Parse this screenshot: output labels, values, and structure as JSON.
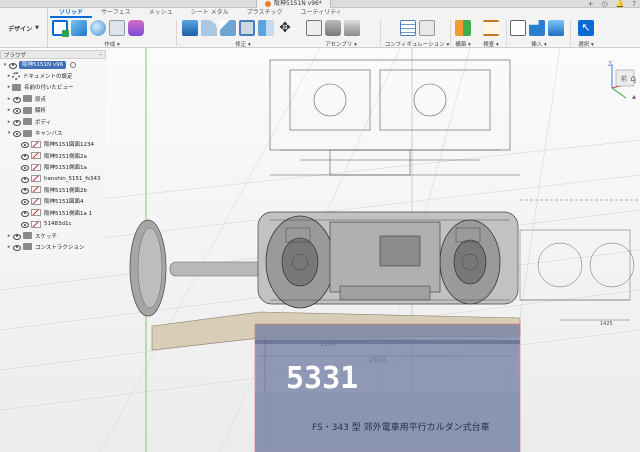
{
  "document": {
    "tab_title": "阪神5151N v96*"
  },
  "workspace": {
    "label": "デザイン"
  },
  "ribbon": {
    "tabs": [
      {
        "label": "ソリッド",
        "active": true
      },
      {
        "label": "サーフェス",
        "active": false
      },
      {
        "label": "メッシュ",
        "active": false
      },
      {
        "label": "シート メタル",
        "active": false
      },
      {
        "label": "プラスチック",
        "active": false
      },
      {
        "label": "ユーティリティ",
        "active": false
      }
    ],
    "groups": {
      "create": "作成",
      "modify": "修正",
      "assemble": "アセンブリ",
      "configure": "コンフィギュレーション",
      "construct": "構築",
      "inspect": "検査",
      "insert": "挿入",
      "select": "選択"
    }
  },
  "browser": {
    "title": "ブラウザ",
    "items": [
      {
        "label": "阪神5151N v96",
        "level": 0,
        "type": "root"
      },
      {
        "label": "ドキュメントの設定",
        "level": 1,
        "type": "gear"
      },
      {
        "label": "名前の付いたビュー",
        "level": 1,
        "type": "folder"
      },
      {
        "label": "原点",
        "level": 1,
        "type": "folder"
      },
      {
        "label": "解析",
        "level": 1,
        "type": "folder"
      },
      {
        "label": "ボディ",
        "level": 1,
        "type": "folder"
      },
      {
        "label": "キャンバス",
        "level": 1,
        "type": "folder-open"
      },
      {
        "label": "阪神5151図面1234",
        "level": 2,
        "type": "canvas"
      },
      {
        "label": "阪神5151側面2a",
        "level": 2,
        "type": "canvas"
      },
      {
        "label": "阪神5151側面1a",
        "level": 2,
        "type": "canvas"
      },
      {
        "label": "hanshin_5151_fs343",
        "level": 2,
        "type": "canvas"
      },
      {
        "label": "阪神5151側面2b",
        "level": 2,
        "type": "canvas"
      },
      {
        "label": "阪神5151図面4",
        "level": 2,
        "type": "canvas"
      },
      {
        "label": "阪神5151側面1a 1",
        "level": 2,
        "type": "canvas"
      },
      {
        "label": "51483d1c",
        "level": 2,
        "type": "canvas"
      },
      {
        "label": "スケッチ",
        "level": 1,
        "type": "folder"
      },
      {
        "label": "コンストラクション",
        "level": 1,
        "type": "folder"
      }
    ]
  },
  "canvas_text": {
    "car_number": "5331",
    "caption": "FS・343 型  郊外電車用平行カルダン式台車",
    "dimensions": [
      "2100",
      "2150",
      "1425"
    ]
  },
  "viewcube": {
    "axis": "Z",
    "face": "前"
  },
  "colors": {
    "accent": "#0a6bd5",
    "root_badge": "#3f6fb5",
    "axis_green": "#3aa53a",
    "axis_red": "#d94040"
  }
}
